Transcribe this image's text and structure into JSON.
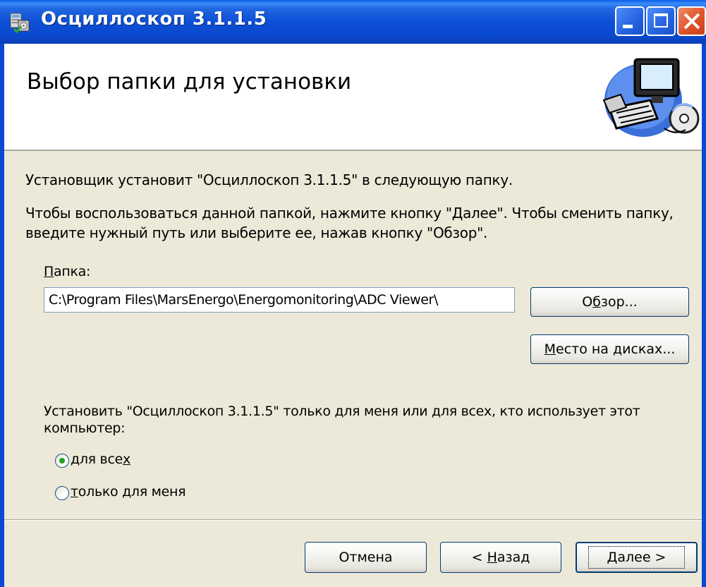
{
  "window": {
    "title": "Осциллоскоп 3.1.1.5",
    "icon": "installer-icon"
  },
  "banner": {
    "title": "Выбор папки для установки",
    "art": "computer-illustration"
  },
  "body": {
    "intro": "Установщик установит \"Осциллоскоп 3.1.1.5\" в следующую папку.",
    "instructions": "Чтобы воспользоваться данной папкой, нажмите кнопку \"Далее\". Чтобы сменить папку, введите нужный путь или выберите ее, нажав кнопку \"Обзор\".",
    "folder_label_underlined": "П",
    "folder_label_rest": "апка:",
    "folder_value": "C:\\Program Files\\MarsEnergo\\Energomonitoring\\ADC Viewer\\",
    "browse_label_pre": "О",
    "browse_label_underlined": "б",
    "browse_label_post": "зор...",
    "disk_label_underlined": "М",
    "disk_label_rest": "есто на дисках...",
    "scope_question": "Установить \"Осциллоскоп 3.1.1.5\" только для меня или для всех, кто использует этот компьютер:",
    "radio_all_pre": "для все",
    "radio_all_underlined": "х",
    "radio_me_underlined": "т",
    "radio_me_rest": "олько для меня",
    "selected_scope": "all"
  },
  "footer": {
    "cancel_label": "Отмена",
    "back_pre": "< ",
    "back_underlined": "Н",
    "back_rest": "азад",
    "next_underlined": "Д",
    "next_rest": "алее >"
  }
}
